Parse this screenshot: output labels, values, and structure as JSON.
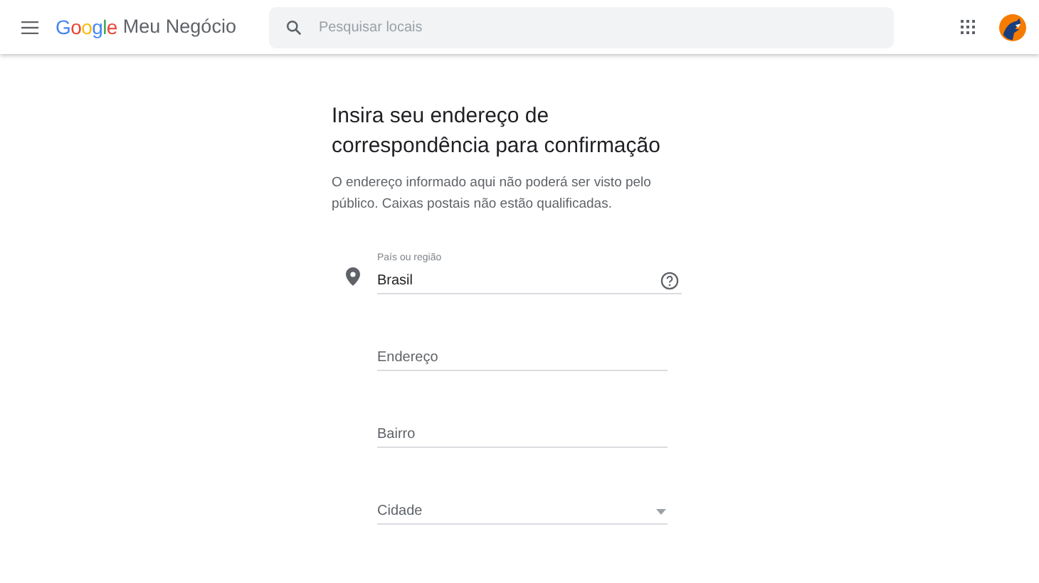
{
  "header": {
    "logo": "Google",
    "product": "Meu Negócio",
    "search": {
      "placeholder": "Pesquisar locais"
    }
  },
  "form": {
    "title": "Insira seu endereço de correspondência para confirmação",
    "description": "O endereço informado aqui não poderá ser visto pelo público. Caixas postais não estão qualificadas.",
    "fields": [
      {
        "kind": "country",
        "label": "País ou região",
        "value": "Brasil"
      },
      {
        "kind": "text",
        "placeholder": "Endereço"
      },
      {
        "kind": "text",
        "placeholder": "Bairro"
      },
      {
        "kind": "select",
        "placeholder": "Cidade"
      }
    ]
  }
}
